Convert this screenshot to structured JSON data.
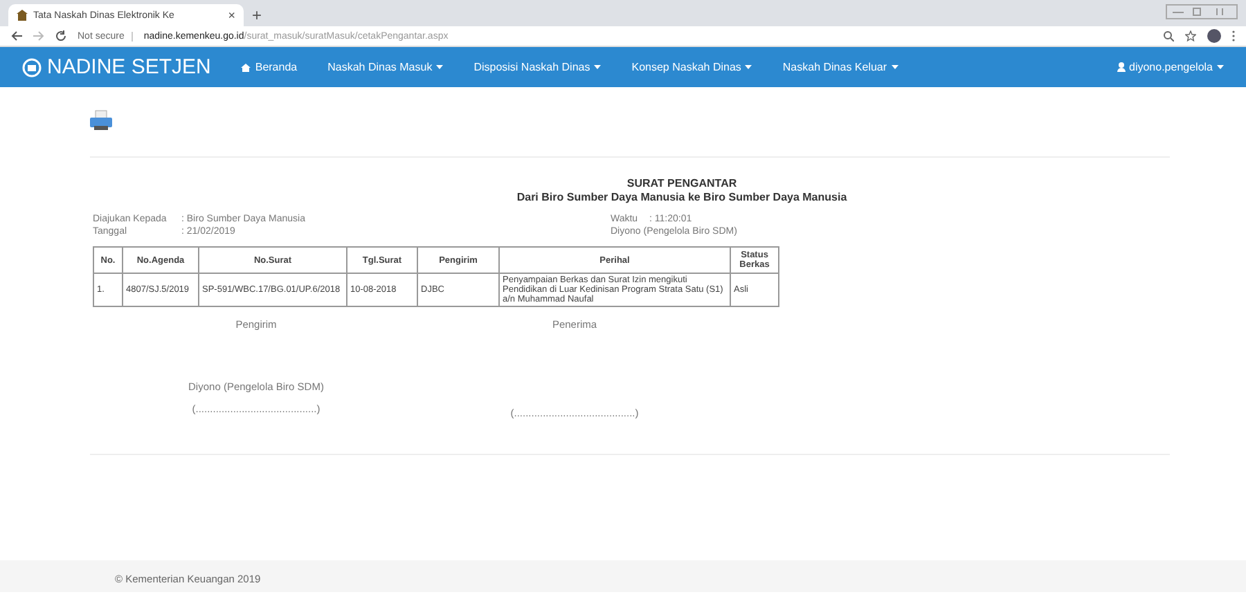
{
  "browser": {
    "tab_title": "Tata Naskah Dinas Elektronik Ke",
    "tab_close": "×",
    "new_tab": "+",
    "security": "Not secure",
    "url": "**nadine.kemenkeu.go.id**/surat_masuk/suratMasuk/cetakPengantar.aspx"
  },
  "navbar": {
    "brand": "NADINE SETJEN",
    "items": [
      {
        "label": "Beranda",
        "kind": "home"
      },
      {
        "label": "Naskah Dinas Masuk",
        "kind": "dropdown"
      },
      {
        "label": "Disposisi Naskah Dinas",
        "kind": "dropdown"
      },
      {
        "label": "Konsep Naskah Dinas",
        "kind": "dropdown"
      },
      {
        "label": "Naskah Dinas Keluar",
        "kind": "dropdown"
      }
    ],
    "user": "diyono.pengelola"
  },
  "document": {
    "title": "SURAT PENGANTAR",
    "subtitle": "Dari Biro Sumber Daya Manusia ke Biro Sumber Daya Manusia",
    "left_info": [
      {
        "label": "Diajukan Kepada",
        "value": ": Biro Sumber Daya Manusia"
      },
      {
        "label": "Tanggal",
        "value": ": 21/02/2019"
      }
    ],
    "right_info": [
      {
        "label": "Waktu",
        "value": ": 11:20:01"
      },
      {
        "value": "Diyono (Pengelola Biro SDM)"
      }
    ],
    "table": {
      "columns": [
        "No.",
        "No.Agenda",
        "No.Surat",
        "Tgl.Surat",
        "Pengirim",
        "Perihal",
        "Status Berkas"
      ],
      "rows": [
        [
          "1.",
          "4807/SJ.5/2019",
          "SP-591/WBC.17/BG.01/UP.6/2018",
          "10-08-2018",
          "DJBC",
          "Penyampaian Berkas dan Surat Izin mengikuti Pendidikan di Luar Kedinisan Program Strata Satu (S1) a/n Muhammad Naufal",
          "Asli"
        ]
      ]
    },
    "sender": {
      "heading": "Pengirim",
      "name": "Diyono (Pengelola Biro SDM)",
      "signature": "(..........................................)"
    },
    "receiver": {
      "heading": "Penerima",
      "signature": "(..........................................)"
    }
  },
  "footer": "© Kementerian Keuangan 2019"
}
